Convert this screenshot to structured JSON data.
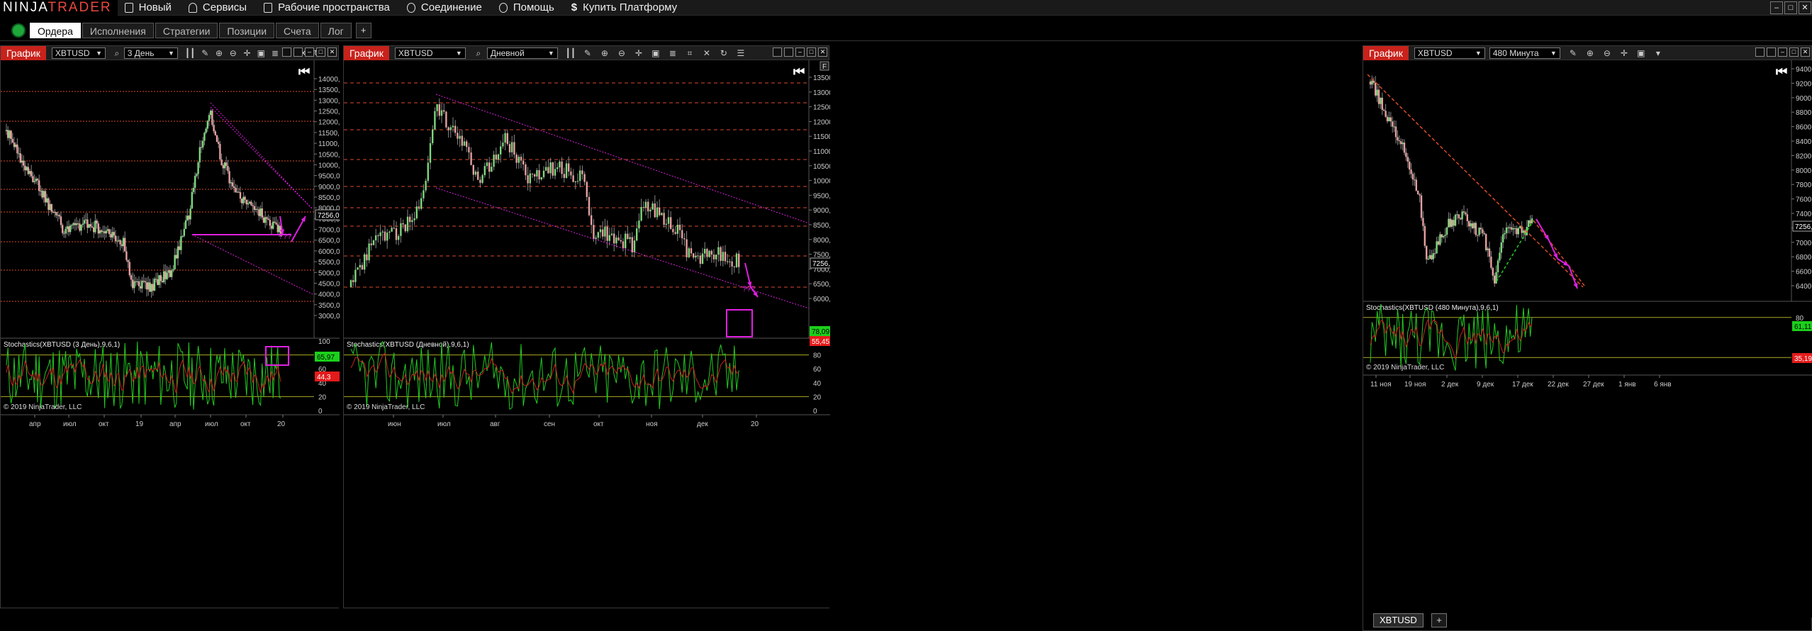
{
  "app": {
    "logo_left": "NINJA",
    "logo_right": "TRADER",
    "menu": [
      {
        "label": "Новый",
        "icon": "file-icon"
      },
      {
        "label": "Сервисы",
        "icon": "tools-icon"
      },
      {
        "label": "Рабочие пространства",
        "icon": "document-icon"
      },
      {
        "label": "Соединение",
        "icon": "plug-icon"
      },
      {
        "label": "Помощь",
        "icon": "help-icon"
      },
      {
        "label": "Купить Платформу",
        "icon": "dollar-icon"
      }
    ]
  },
  "control_center": {
    "tabs": [
      "Ордера",
      "Исполнения",
      "Стратегии",
      "Позиции",
      "Счета",
      "Лог"
    ],
    "active": 0,
    "add": "+"
  },
  "charts": [
    {
      "title": "График",
      "instrument": "XBTUSD",
      "period": "3 День",
      "price_ticks": [
        "14000,0",
        "13500,0",
        "13000,0",
        "12500,0",
        "12000,0",
        "11500,0",
        "11000,0",
        "10500,0",
        "10000,0",
        "9500,0",
        "9000,0",
        "8500,0",
        "8000,0",
        "7500,0",
        "7000,0",
        "6500,0",
        "6000,0",
        "5500,0",
        "5000,0",
        "4500,0",
        "4000,0",
        "3500,0",
        "3000,0"
      ],
      "price_tag": "7256,0",
      "question": "???",
      "indicator_label": "Stochastics(XBTUSD (3 День),9,6,1)",
      "osc_ticks": [
        "100",
        "80",
        "60",
        "40",
        "20",
        "0"
      ],
      "osc_tag_top": "65,97",
      "osc_tag_bottom": "44,3",
      "copyright": "© 2019 NinjaTrader, LLC",
      "time_ticks": [
        "апр",
        "июл",
        "окт",
        "19",
        "апр",
        "июл",
        "окт",
        "20"
      ]
    },
    {
      "title": "График",
      "instrument": "XBTUSD",
      "period": "Дневной",
      "price_ticks": [
        "13500,0",
        "13000,0",
        "12500,0",
        "12000,0",
        "11500,0",
        "11000,0",
        "10500,0",
        "10000,0",
        "9500,0",
        "9000,0",
        "8500,0",
        "8000,0",
        "7500,0",
        "7000,0",
        "6500,0",
        "6000,0"
      ],
      "price_tag": "7256,0",
      "question": "???",
      "scale_button": "F",
      "indicator_label": "Stochastics(XBTUSD (Дневной),9,6,1)",
      "osc_ticks": [
        "100",
        "80",
        "60",
        "40",
        "20",
        "0"
      ],
      "osc_tag_top": "78,09",
      "osc_tag_bottom": "55,45",
      "copyright": "© 2019 NinjaTrader, LLC",
      "time_ticks": [
        "июн",
        "июл",
        "авг",
        "сен",
        "окт",
        "ноя",
        "дек",
        "20"
      ]
    },
    {
      "title": "График",
      "instrument": "XBTUSD",
      "period": "480 Минута",
      "price_ticks": [
        "9400,0",
        "9200,0",
        "9000,0",
        "8800,0",
        "8600,0",
        "8400,0",
        "8200,0",
        "8000,0",
        "7800,0",
        "7600,0",
        "7400,0",
        "7200,0",
        "7000,0",
        "6800,0",
        "6600,0",
        "6400,0"
      ],
      "price_tag": "7256,0",
      "indicator_label": "Stochastics(XBTUSD (480 Минута),9,6,1)",
      "osc_ticks": [
        "80",
        "20"
      ],
      "osc_tag_top": "61,11",
      "osc_tag_bottom": "35,19",
      "copyright": "© 2019 NinjaTrader, LLC",
      "time_ticks": [
        "11 ноя",
        "19 ноя",
        "2 дек",
        "9 дек",
        "17 дек",
        "22 дек",
        "27 дек",
        "1 янв",
        "6 янв"
      ],
      "bottom_tab": "XBTUSD",
      "bottom_add": "+"
    }
  ],
  "colors": {
    "title_red": "#c8221b",
    "green_tag": "#1bd01b",
    "red_tag": "#e51b1b",
    "magenta": "#e020e0",
    "level_red": "#d84a2a",
    "osc_green": "#22cc22",
    "osc_red": "#cc2222",
    "osc_level": "#aaaa22"
  }
}
